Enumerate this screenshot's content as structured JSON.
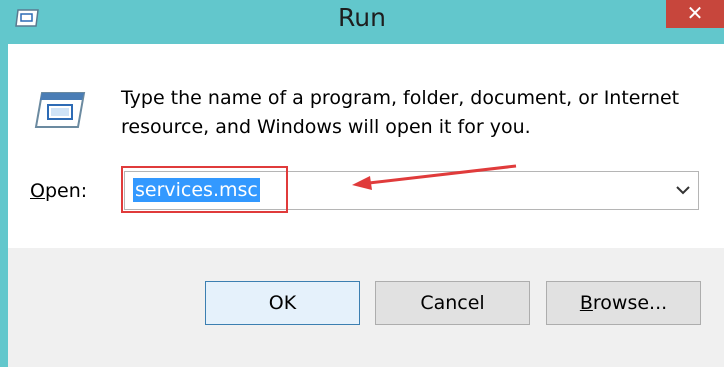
{
  "window": {
    "title": "Run",
    "close_glyph": "✕",
    "icon": "run-app-icon"
  },
  "dialog": {
    "icon": "run-dialog-icon",
    "description": "Type the name of a program, folder, document, or Internet resource, and Windows will open it for you.",
    "open_label_prefix": "O",
    "open_label_rest": "pen:",
    "open_value": "services.msc",
    "dropdown_icon": "chevron-down-icon"
  },
  "buttons": {
    "ok": "OK",
    "cancel": "Cancel",
    "browse_prefix": "B",
    "browse_rest": "rowse..."
  },
  "colors": {
    "frame": "#62c7cc",
    "selection": "#3399ff",
    "annotation": "#e03b3b"
  }
}
